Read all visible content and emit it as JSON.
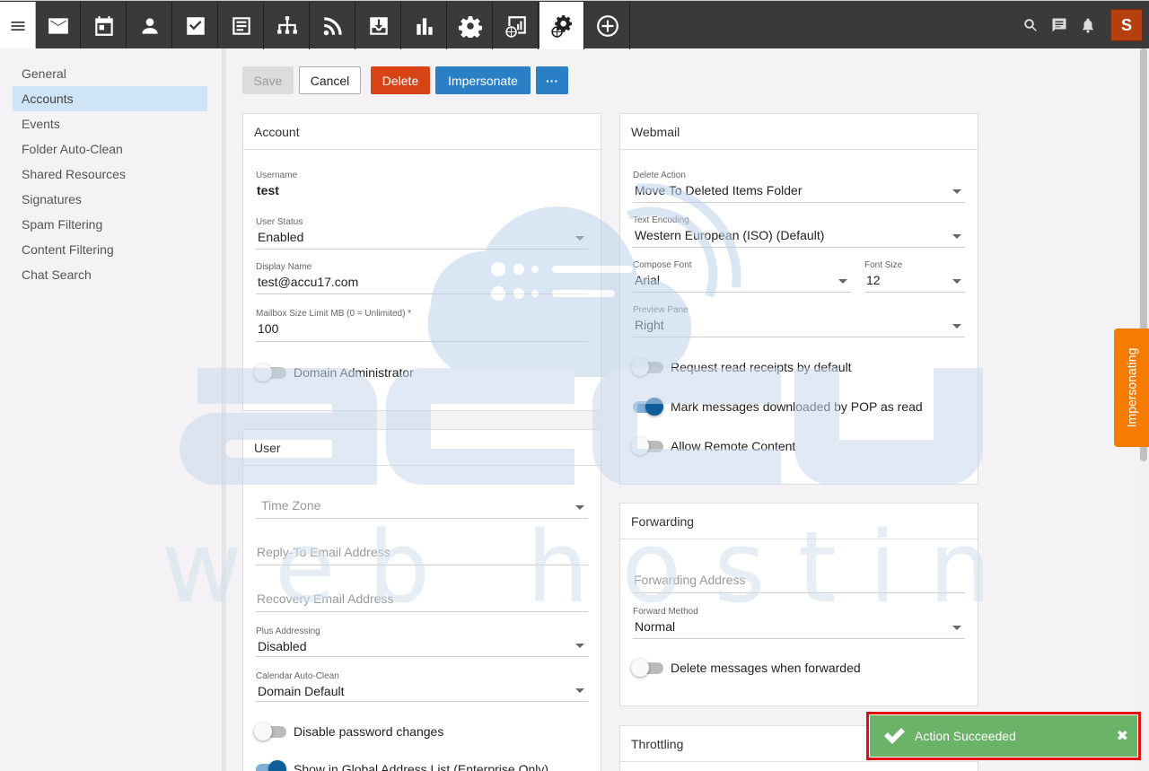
{
  "topnav": {
    "items": [
      {
        "name": "email-icon"
      },
      {
        "name": "calendar-icon"
      },
      {
        "name": "contacts-icon"
      },
      {
        "name": "tasks-icon"
      },
      {
        "name": "notes-icon"
      },
      {
        "name": "network-icon"
      },
      {
        "name": "rss-icon"
      },
      {
        "name": "inbox-download-icon"
      },
      {
        "name": "reports-icon"
      },
      {
        "name": "settings-icon"
      },
      {
        "name": "domain-reports-icon"
      },
      {
        "name": "domain-settings-icon"
      },
      {
        "name": "add-icon"
      }
    ],
    "avatar_letter": "S"
  },
  "sidebar": {
    "items": [
      {
        "label": "General"
      },
      {
        "label": "Accounts"
      },
      {
        "label": "Events"
      },
      {
        "label": "Folder Auto-Clean"
      },
      {
        "label": "Shared Resources"
      },
      {
        "label": "Signatures"
      },
      {
        "label": "Spam Filtering"
      },
      {
        "label": "Content Filtering"
      },
      {
        "label": "Chat Search"
      }
    ],
    "active_index": 1
  },
  "toolbar": {
    "save": "Save",
    "cancel": "Cancel",
    "delete": "Delete",
    "impersonate": "Impersonate",
    "more": "···"
  },
  "account": {
    "title": "Account",
    "username_label": "Username",
    "username": "test",
    "status_label": "User Status",
    "status": "Enabled",
    "display_label": "Display Name",
    "display": "test@accu17.com",
    "mailbox_label": "Mailbox Size Limit MB (0 = Unlimited) *",
    "mailbox": "100",
    "domain_admin": "Domain Administrator"
  },
  "user": {
    "title": "User",
    "timezone_ph": "Time Zone",
    "replyto_ph": "Reply-To Email Address",
    "recovery_ph": "Recovery Email Address",
    "plus_label": "Plus Addressing",
    "plus": "Disabled",
    "autoclean_label": "Calendar Auto-Clean",
    "autoclean": "Domain Default",
    "disable_pw": "Disable password changes",
    "show_gal": "Show in Global Address List (Enterprise Only)"
  },
  "webmail": {
    "title": "Webmail",
    "delete_label": "Delete Action",
    "delete": "Move To Deleted Items Folder",
    "encoding_label": "Text Encoding",
    "encoding": "Western European (ISO) (Default)",
    "font_label": "Compose Font",
    "font": "Arial",
    "size_label": "Font Size",
    "size": "12",
    "preview_label": "Preview Pane",
    "preview": "Right",
    "read_receipts": "Request read receipts by default",
    "mark_pop": "Mark messages downloaded by POP as read",
    "remote": "Allow Remote Content"
  },
  "forwarding": {
    "title": "Forwarding",
    "address_ph": "Forwarding Address",
    "method_label": "Forward Method",
    "method": "Normal",
    "delete_fwd": "Delete messages when forwarded"
  },
  "throttling": {
    "title": "Throttling"
  },
  "watermark": {
    "line1": "accu",
    "line2": "web hosting"
  },
  "impersonating_tab": "Impersonating",
  "toast": {
    "text": "Action Succeeded",
    "close": "✖"
  },
  "colors": {
    "topbar": "#3a3a3a",
    "delete": "#d84315",
    "primary": "#2b80c5",
    "toggle_on": "#0d5e99",
    "impersonating": "#f57c00",
    "toast": "#6cb36a",
    "toast_border": "#e01010"
  }
}
